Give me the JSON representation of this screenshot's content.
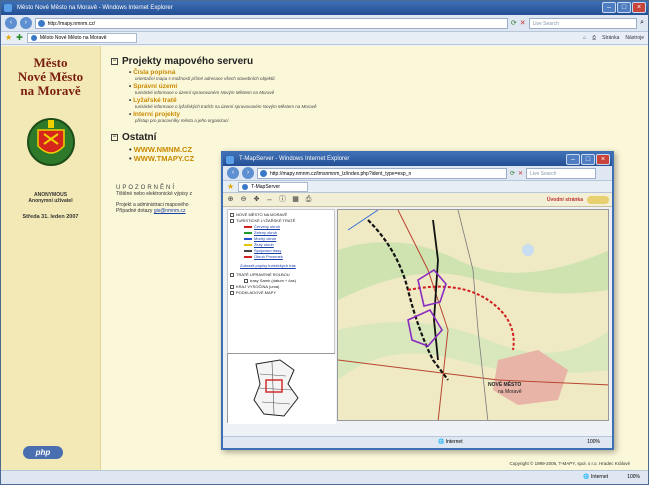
{
  "browser": {
    "title": "Město Nové Město na Moravě - Windows Internet Explorer",
    "address": "http://mapy.nmnm.cz/",
    "search_placeholder": "Live Search",
    "tab_label": "Město Nové Město na Moravě",
    "tools": [
      "Stránka",
      "Nástroje"
    ],
    "status_zone": "Internet",
    "zoom": "100%"
  },
  "sidebar": {
    "city_line1": "Město",
    "city_line2": "Nové Město",
    "city_line3": "na Moravě",
    "user_name": "ANONYMOUS",
    "user_role": "Anonymní uživatel",
    "date": "Středa 31. leden 2007"
  },
  "main": {
    "section1_title": "Projekty mapového serveru",
    "projects": [
      {
        "title": "Čísla popisná",
        "desc": "orientační mapa s možností přímé adresace všech stavebních objektů"
      },
      {
        "title": "Správní území",
        "desc": "turistické informace o území spravovaném Novým Městem na Moravě"
      },
      {
        "title": "Lyžařské tratě",
        "desc": "turistické informace o lyžařských tratích na území spravovaném Novým Městem na Moravě"
      },
      {
        "title": "Interní projekty",
        "desc": "přístup pro pracovníky města a jeho organizací"
      }
    ],
    "section2_title": "Ostatní",
    "links": [
      "WWW.NMNM.CZ",
      "WWW.TMAPY.CZ"
    ]
  },
  "notice": {
    "title": "UPOZORNĚNÍ",
    "line1": "Tištěné nebo elektronické výpisy z",
    "line2": "Projekt a administraci mapového",
    "line3": "Případné dotazy",
    "email": "gis@nmnm.cz"
  },
  "footer": {
    "copyright": "Copyright © 1999-2006, T-MAPY, spol. s r.o. Hradec Králové"
  },
  "popup": {
    "title": "T-MapServer - Windows Internet Explorer",
    "address": "http://mapy.nmnm.cz/tmsnmnm_lz/index.php?ident_type=esp_n",
    "search_placeholder": "Live Search",
    "tab_label": "T-MapServer",
    "toolbar_link": "Úvodní stránka",
    "layers": [
      {
        "label": "NOVÉ MĚSTO NA MORAVĚ",
        "level": 0
      },
      {
        "label": "TURISTICKÉ LYŽAŘSKÉ TRATĚ",
        "level": 0
      },
      {
        "label": "Červený okruh",
        "level": 1,
        "color": "#d22020"
      },
      {
        "label": "Zelený okruh",
        "level": 1,
        "color": "#1e9a2e"
      },
      {
        "label": "Modrý okruh",
        "level": 1,
        "color": "#2a4fd0"
      },
      {
        "label": "Žlutý okruh",
        "level": 1,
        "color": "#e6c400"
      },
      {
        "label": "Spojovací trasy",
        "level": 1,
        "color": "#444444"
      },
      {
        "label": "Okruh Prosenek",
        "level": 1,
        "color": "#d22020"
      }
    ],
    "layers_link": "Zobrazit popisy turistických tras",
    "layers_extra": [
      {
        "label": "TRATĚ UPRAVENÉ ROLBOU"
      },
      {
        "label": "trasy Sarek (datum + čas)"
      },
      {
        "label": "KRAJ VYSOČINA (uma)"
      },
      {
        "label": "PODKLADOVÉ MAPY"
      }
    ],
    "map_label": "NOVÉ MĚSTO",
    "map_sublabel": "na Moravě",
    "status_zone": "Internet",
    "zoom": "100%"
  }
}
